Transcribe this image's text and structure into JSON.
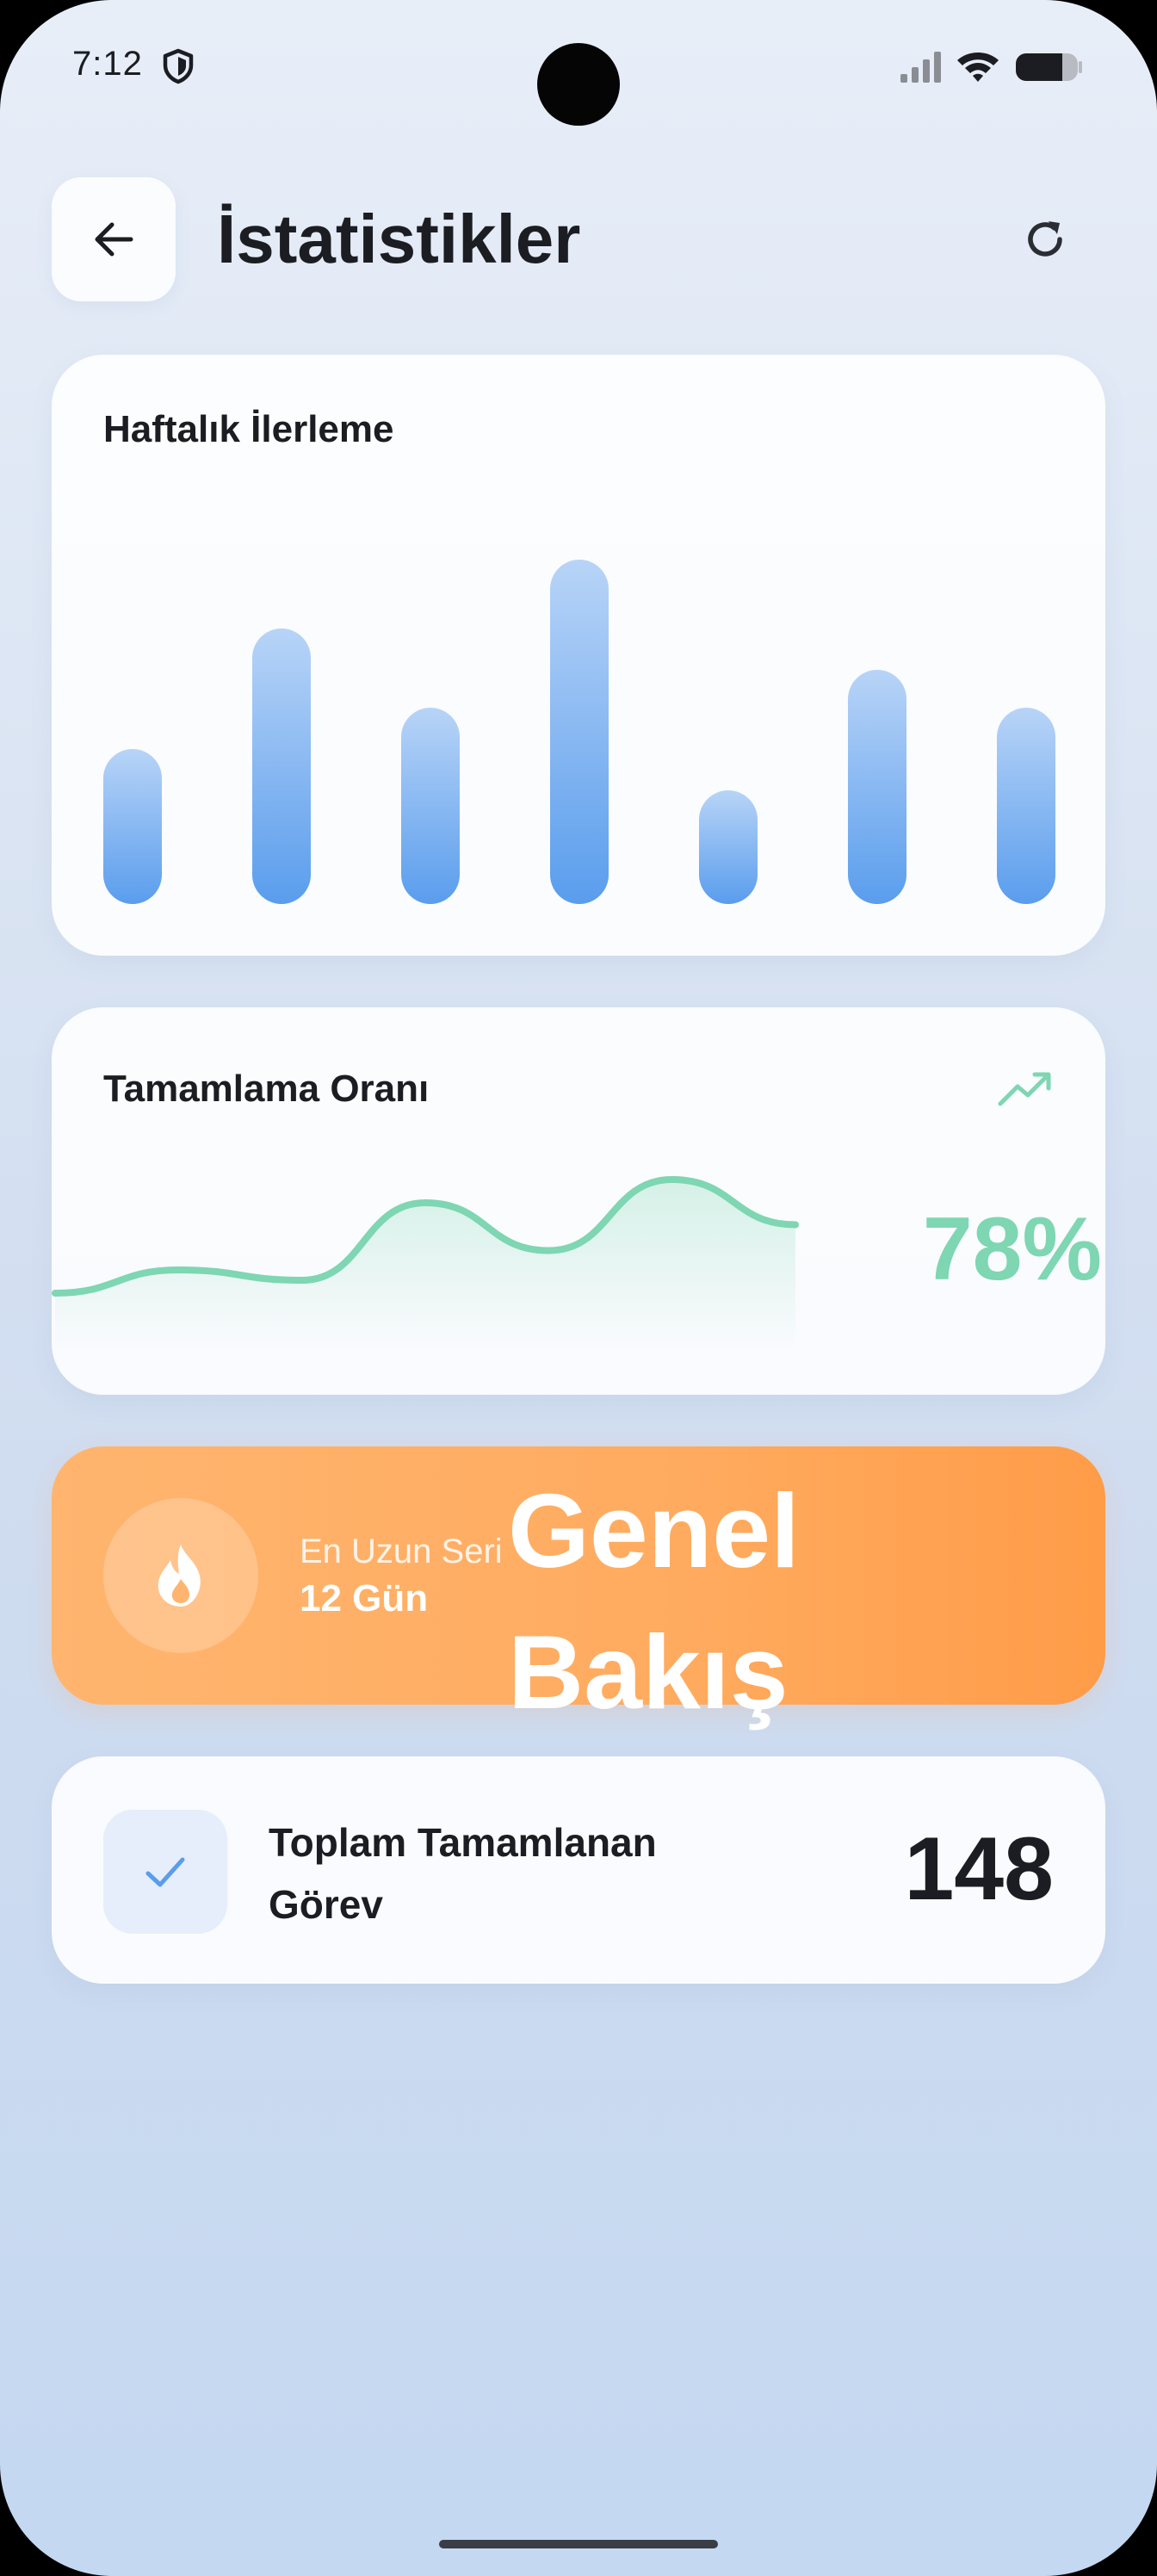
{
  "status_bar": {
    "time": "7:12",
    "icons": [
      "shield-icon",
      "signal-icon",
      "wifi-icon",
      "battery-icon"
    ]
  },
  "header": {
    "title": "İstatistikler",
    "back_icon": "arrow-left-icon",
    "refresh_icon": "refresh-icon"
  },
  "weekly": {
    "title": "Haftalık İlerleme"
  },
  "completion": {
    "title": "Tamamlama Oranı",
    "value": "78%",
    "trend_icon": "trending-up-icon"
  },
  "streak": {
    "label": "En Uzun Seri",
    "value": "12 Gün",
    "overlay_title": "Genel Bakış",
    "icon": "flame-icon"
  },
  "total": {
    "label": "Toplam Tamamlanan Görev",
    "value": "148",
    "icon": "check-icon"
  },
  "colors": {
    "accent_blue": "#5a9ded",
    "accent_green": "#7ed6b2",
    "accent_orange": "#ffab5f",
    "text_dark": "#1b1d22"
  },
  "chart_data": [
    {
      "type": "bar",
      "title": "Haftalık İlerleme",
      "categories": [],
      "values": [
        0.45,
        0.8,
        0.57,
        1.0,
        0.33,
        0.68,
        0.57
      ],
      "grid": false
    },
    {
      "type": "area",
      "title": "Tamamlama Oranı",
      "values": [
        0.12,
        0.3,
        0.22,
        0.82,
        0.45,
        1.0,
        0.65
      ],
      "grid": false
    }
  ]
}
